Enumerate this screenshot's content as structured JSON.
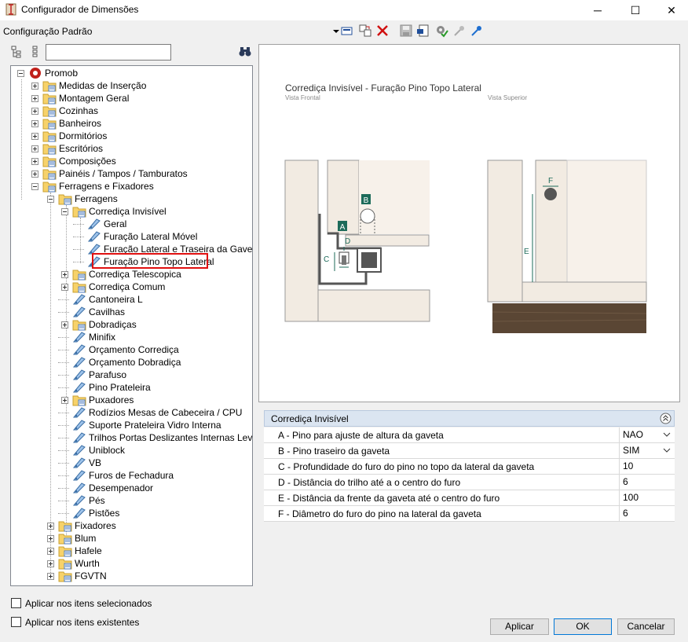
{
  "window": {
    "title": "Configurador de Dimensões",
    "minimize": "─",
    "maximize": "☐",
    "close": "✕"
  },
  "config_label": "Configuração Padrão",
  "search": {
    "value": "",
    "placeholder": ""
  },
  "tree": {
    "root": "Promob",
    "level1": [
      "Medidas de Inserção",
      "Montagem Geral",
      "Cozinhas",
      "Banheiros",
      "Dormitórios",
      "Escritórios",
      "Composições",
      "Painéis / Tampos / Tamburatos",
      "Ferragens e Fixadores"
    ],
    "ferragens": "Ferragens",
    "corredica_invisivel": "Corrediça Invisível",
    "corredica_children": [
      "Geral",
      "Furação Lateral Móvel",
      "Furação Lateral e Traseira da Gaveta",
      "Furação Pino Topo Lateral"
    ],
    "ferragens_children": [
      "Corrediça Telescopica",
      "Corrediça Comum",
      "Cantoneira L",
      "Cavilhas",
      "Dobradiças",
      "Minifix",
      "Orçamento Corrediça",
      "Orçamento Dobradiça",
      "Parafuso",
      "Pino Prateleira",
      "Puxadores",
      "Rodízios Mesas de Cabeceira / CPU",
      "Suporte Prateleira Vidro Interna",
      "Trilhos Portas Deslizantes Internas Leves",
      "Uniblock",
      "VB",
      "Furos de Fechadura",
      "Desempenador",
      "Pés",
      "Pistões"
    ],
    "fixadores_children": [
      "Fixadores",
      "Blum",
      "Hafele",
      "Wurth",
      "FGVTN"
    ]
  },
  "preview": {
    "title": "Corrediça Invisível - Furação Pino Topo Lateral",
    "view_front": "Vista Frontal",
    "view_top": "Vista Superior",
    "labels": [
      "A",
      "B",
      "C",
      "D",
      "E",
      "F"
    ]
  },
  "properties": {
    "group": "Corrediça Invisível",
    "rows": [
      {
        "name": "A - Pino para ajuste de altura da gaveta",
        "value": "NAO"
      },
      {
        "name": "B - Pino traseiro da gaveta",
        "value": "SIM"
      },
      {
        "name": "C - Profundidade do furo do pino no topo da lateral da gaveta",
        "value": "10"
      },
      {
        "name": "D - Distância do trilho até a o centro do furo",
        "value": "6"
      },
      {
        "name": "E - Distância da frente da gaveta até o centro do furo",
        "value": "100"
      },
      {
        "name": "F - Diâmetro do furo do pino na lateral da gaveta",
        "value": "6"
      }
    ]
  },
  "options": {
    "apply_selected": "Aplicar nos itens selecionados",
    "apply_existing": "Aplicar nos itens existentes"
  },
  "buttons": {
    "apply": "Aplicar",
    "ok": "OK",
    "cancel": "Cancelar"
  },
  "colors": {
    "selection_border": "#e01010",
    "group_header": "#dbe5f1",
    "label_teal": "#1d6b5a",
    "wood_light": "#f2ebe2",
    "wood_dark": "#5a4634"
  }
}
